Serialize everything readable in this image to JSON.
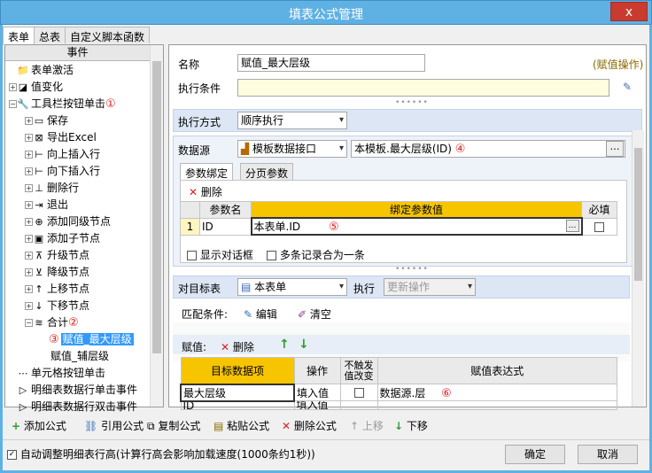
{
  "window": {
    "title": "填表公式管理",
    "close": "x"
  },
  "tabs": [
    "表单",
    "总表",
    "自定义脚本函数"
  ],
  "tree": {
    "header": "事件",
    "nodes": [
      {
        "indent": 1,
        "exp": "",
        "icon": "📁",
        "label": "表单激活"
      },
      {
        "indent": 1,
        "exp": "+",
        "icon": "◪",
        "label": "值变化"
      },
      {
        "indent": 1,
        "exp": "−",
        "icon": "🔧",
        "label": "工具栏按钮单击",
        "mark": "①"
      },
      {
        "indent": 2,
        "exp": "+",
        "icon": "▭",
        "label": "保存"
      },
      {
        "indent": 2,
        "exp": "+",
        "icon": "⊠",
        "label": "导出Excel"
      },
      {
        "indent": 2,
        "exp": "+",
        "icon": "⊢",
        "label": "向上插入行"
      },
      {
        "indent": 2,
        "exp": "+",
        "icon": "⊢",
        "label": "向下插入行"
      },
      {
        "indent": 2,
        "exp": "+",
        "icon": "⊥",
        "label": "删除行"
      },
      {
        "indent": 2,
        "exp": "+",
        "icon": "⇥",
        "label": "退出"
      },
      {
        "indent": 2,
        "exp": "+",
        "icon": "⊕",
        "label": "添加同级节点"
      },
      {
        "indent": 2,
        "exp": "+",
        "icon": "▣",
        "label": "添加子节点"
      },
      {
        "indent": 2,
        "exp": "+",
        "icon": "⊼",
        "label": "升级节点"
      },
      {
        "indent": 2,
        "exp": "+",
        "icon": "⊻",
        "label": "降级节点"
      },
      {
        "indent": 2,
        "exp": "+",
        "icon": "↑",
        "label": "上移节点"
      },
      {
        "indent": 2,
        "exp": "+",
        "icon": "↓",
        "label": "下移节点"
      },
      {
        "indent": 2,
        "exp": "−",
        "icon": "≋",
        "label": "合计",
        "mark": "②"
      },
      {
        "indent": 3,
        "exp": "",
        "icon": "",
        "label": "赋值_最大层级",
        "mark": "③",
        "selected": true
      },
      {
        "indent": 3,
        "exp": "",
        "icon": "",
        "label": "赋值_辅层级"
      },
      {
        "indent": 1,
        "exp": "",
        "icon": "⋯",
        "label": "单元格按钮单击"
      },
      {
        "indent": 1,
        "exp": "",
        "icon": "▷",
        "label": "明细表数据行单击事件"
      },
      {
        "indent": 1,
        "exp": "",
        "icon": "▷",
        "label": "明细表数据行双击事件"
      }
    ]
  },
  "form": {
    "name_label": "名称",
    "name_value": "赋值_最大层级",
    "type_tag": "(赋值操作)",
    "cond_label": "执行条件",
    "cond_value": "",
    "mode_label": "执行方式",
    "mode_value": "顺序执行",
    "ds_label": "数据源",
    "ds_value": "模板数据接口",
    "ds_path": "本模板.最大层级(ID)",
    "ds_mark": "④",
    "subtabs": [
      "参数绑定",
      "分页参数"
    ],
    "delete": "删除",
    "param_headers": [
      "参数名",
      "绑定参数值",
      "必填"
    ],
    "param_rows": [
      {
        "no": "1",
        "name": "ID",
        "value": "本表单.ID",
        "mark": "⑤"
      }
    ],
    "show_dialog": "显示对话框",
    "merge_multi": "多条记录合为一条",
    "target_label": "对目标表",
    "target_value": "本表单",
    "exec_label": "执行",
    "exec_value": "更新操作",
    "match_label": "匹配条件:",
    "edit": "编辑",
    "clear": "清空",
    "assign_label": "赋值:",
    "assign_delete": "删除",
    "assign_headers": [
      "目标数据项",
      "操作",
      "不触发值改变",
      "赋值表达式"
    ],
    "assign_rows": [
      {
        "target": "最大层级",
        "op": "填入值",
        "expr": "数据源.层",
        "mark": "⑥"
      },
      {
        "target": "ID",
        "op": "填入值",
        "expr": ""
      }
    ]
  },
  "toolbar": {
    "add": "添加公式",
    "ref": "引用公式",
    "copy": "复制公式",
    "paste": "粘贴公式",
    "del": "删除公式",
    "up": "上移",
    "down": "下移"
  },
  "footer": {
    "auto_row": "自动调整明细表行高(计算行高会影响加载速度(1000条约1秒))",
    "ok": "确定",
    "cancel": "取消"
  }
}
